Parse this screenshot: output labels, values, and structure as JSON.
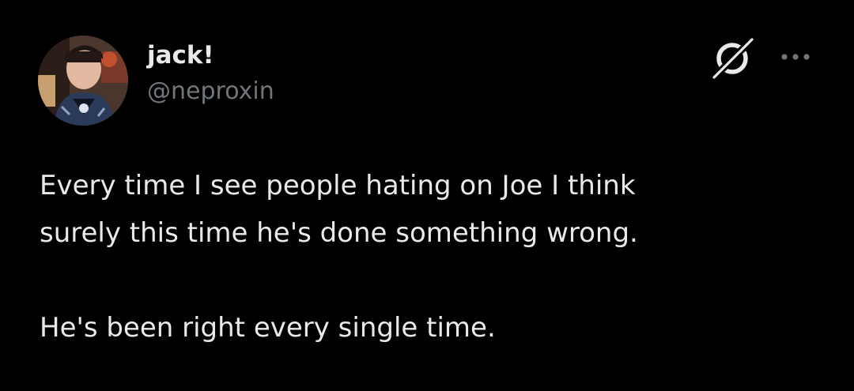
{
  "author": {
    "display_name": "jack!",
    "handle": "@neproxin"
  },
  "icons": {
    "grok": "grok-icon",
    "more": "more-options-icon",
    "avatar": "avatar"
  },
  "tweet": {
    "lines": [
      "Every time I see people hating on Joe I think",
      "surely this time he's done something wrong.",
      "He's been right every single time."
    ]
  },
  "colors": {
    "background": "#000000",
    "text_primary": "#e7e9ea",
    "text_secondary": "#71767b"
  }
}
